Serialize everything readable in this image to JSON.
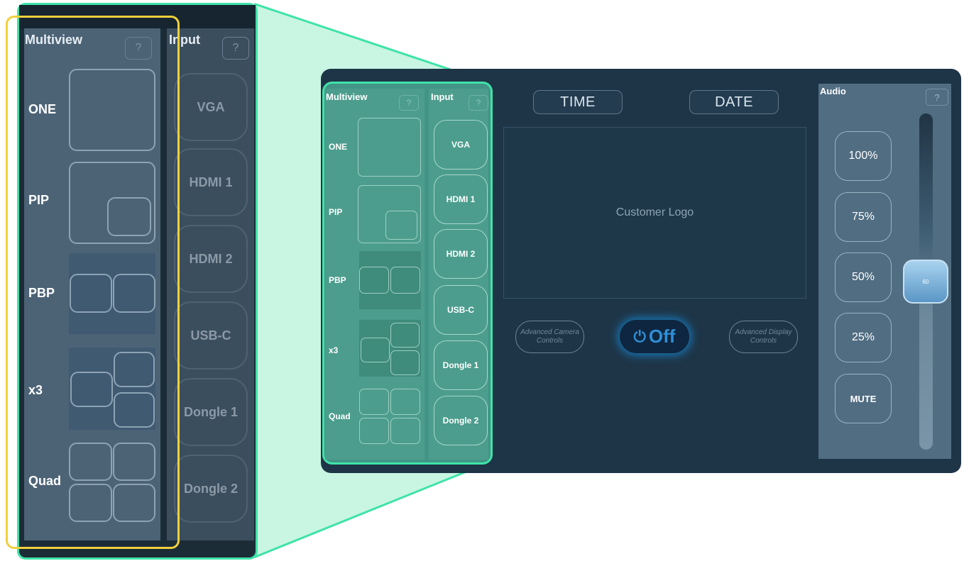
{
  "multiview": {
    "title": "Multiview",
    "help": "?",
    "layouts": [
      "ONE",
      "PIP",
      "PBP",
      "x3",
      "Quad"
    ]
  },
  "input": {
    "title": "Input",
    "help": "?",
    "sources": [
      "VGA",
      "HDMI 1",
      "HDMI 2",
      "USB-C",
      "Dongle 1",
      "Dongle 2"
    ]
  },
  "header": {
    "time_label": "TIME",
    "date_label": "DATE"
  },
  "logo": {
    "text": "Customer Logo"
  },
  "controls": {
    "advanced_camera": "Advanced Camera Controls",
    "advanced_display": "Advanced Display Controls",
    "power_label": "Off",
    "power_icon": "power-icon",
    "power_color": "#2f8fd6"
  },
  "audio": {
    "title": "Audio",
    "help": "?",
    "presets": [
      "100%",
      "75%",
      "50%",
      "25%",
      "MUTE"
    ],
    "volume_value": "60"
  },
  "colors": {
    "zoom_highlight": "#3fe3a8",
    "selection_frame": "#f1cf3c",
    "panel_bg": "#1e3547"
  }
}
